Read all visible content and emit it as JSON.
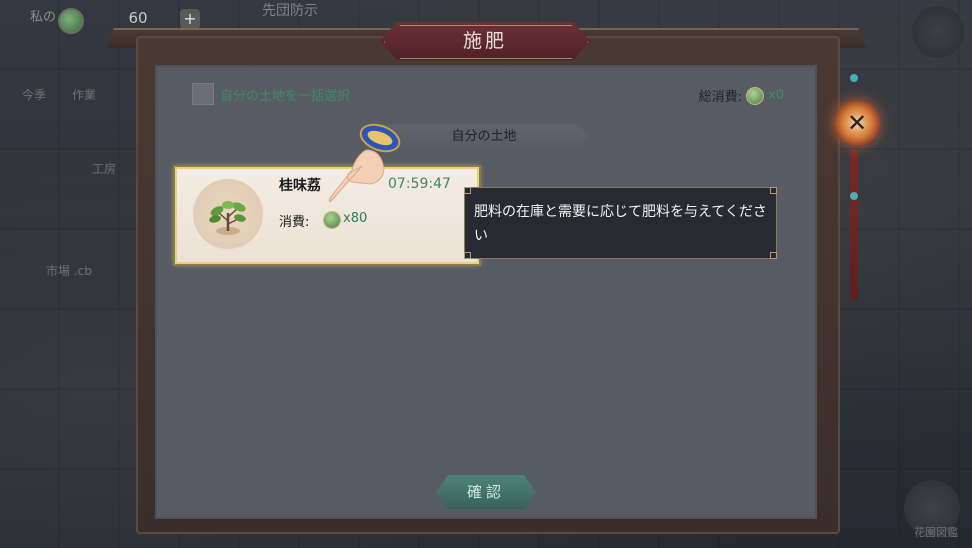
{
  "background": {
    "resource_label": "私の",
    "resource_value": "60",
    "resource_plus": "+",
    "title_partial": "先団防示",
    "side_items": [
      "今季",
      "作業",
      "工房",
      "市場 .cb"
    ],
    "garden_label": "花園図鑑"
  },
  "dialog": {
    "title": "施肥",
    "select_all_label": "自分の土地を一括選択",
    "total_label": "総消費:",
    "total_count": "x0",
    "section_label": "自分の土地",
    "plot": {
      "name": "桂味荔",
      "timer": "07:59:47",
      "consume_label": "消費:",
      "consume_count": "x80"
    },
    "tooltip": "肥料の在庫と需要に応じて肥料を与えてください",
    "confirm_label": "確認",
    "close_glyph": "✕"
  },
  "colors": {
    "accent_green": "#3f8a62",
    "card_highlight": "#e6d27a",
    "title_plate": "#6e3138"
  }
}
